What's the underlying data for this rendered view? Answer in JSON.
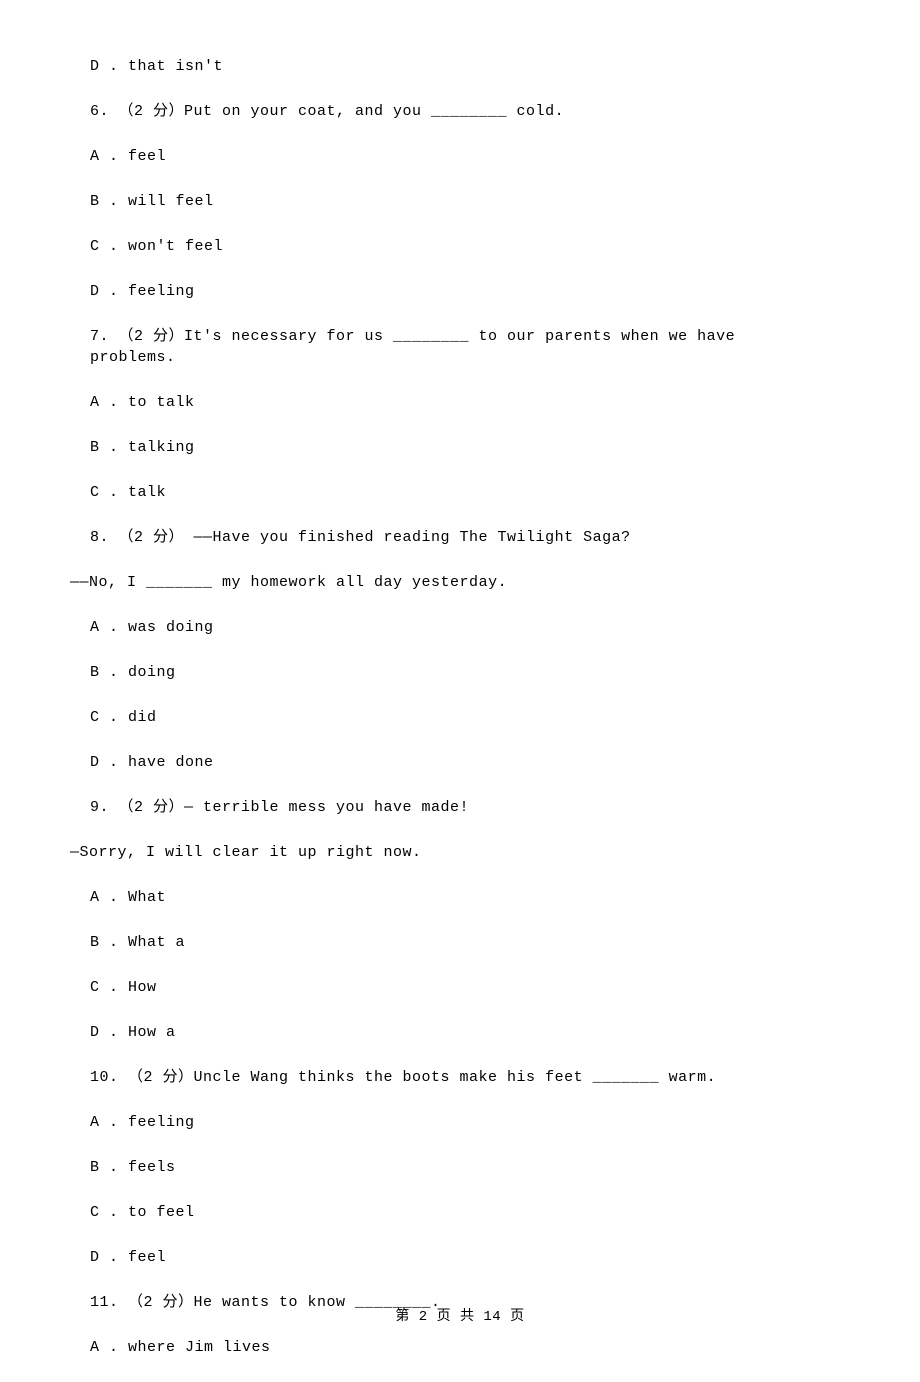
{
  "lines": {
    "q5d": "D . that isn't",
    "q6": "6. （2 分）Put on your coat, and you ________ cold.",
    "q6a": "A . feel",
    "q6b": "B . will feel",
    "q6c": "C . won't feel",
    "q6d": "D . feeling",
    "q7": "7. （2 分）It's necessary for us ________ to our parents when we have problems.",
    "q7a": "A . to talk",
    "q7b": "B . talking",
    "q7c": "C . talk",
    "q8": "8. （2 分） ——Have you finished reading The Twilight Saga?",
    "q8sub": "——No, I _______ my homework all day yesterday.",
    "q8a": "A . was doing",
    "q8b": "B . doing",
    "q8c": "C . did",
    "q8d": "D . have done",
    "q9": "9. （2 分）—           terrible mess you have made!",
    "q9sub": "—Sorry, I will clear it up right now.",
    "q9a": "A . What",
    "q9b": "B . What a",
    "q9c": "C . How",
    "q9d": "D . How a",
    "q10": "10. （2 分）Uncle Wang thinks the boots make his feet _______ warm.",
    "q10a": "A . feeling",
    "q10b": "B . feels",
    "q10c": "C . to feel",
    "q10d": "D . feel",
    "q11": "11. （2 分）He wants to know ________.",
    "q11a": "A . where Jim lives"
  },
  "footer": "第 2 页 共 14 页"
}
